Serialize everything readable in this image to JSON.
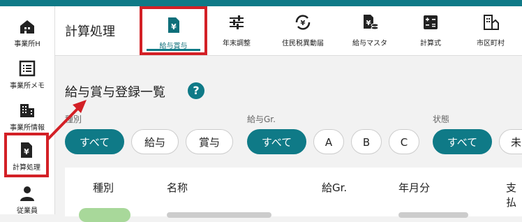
{
  "sidebar": {
    "items": [
      {
        "label": "事業所H",
        "icon": "office-home-icon"
      },
      {
        "label": "事業所メモ",
        "icon": "memo-list-icon"
      },
      {
        "label": "事業所情報",
        "icon": "building-icon"
      },
      {
        "label": "計算処理",
        "icon": "yen-document-icon"
      },
      {
        "label": "従業員",
        "icon": "person-icon"
      }
    ]
  },
  "header": {
    "title": "計算処理",
    "tabs": [
      {
        "label": "給与賞与",
        "icon": "yen-document-icon"
      },
      {
        "label": "年末調整",
        "icon": "sliders-icon"
      },
      {
        "label": "住民税異動届",
        "icon": "yen-cycle-icon"
      },
      {
        "label": "給与マスタ",
        "icon": "yen-database-icon"
      },
      {
        "label": "計算式",
        "icon": "calculator-icon"
      },
      {
        "label": "市区町村",
        "icon": "city-building-icon"
      }
    ]
  },
  "main": {
    "section_title": "給与賞与登録一覧",
    "help_glyph": "?",
    "filters": {
      "type_label": "種別",
      "type_chips": [
        "すべて",
        "給与",
        "賞与"
      ],
      "group_label": "給与Gr.",
      "group_chips": [
        "すべて",
        "A",
        "B",
        "C"
      ],
      "status_label": "状態",
      "status_chips": [
        "すべて",
        "未"
      ]
    },
    "table": {
      "headers": [
        "種別",
        "名称",
        "給Gr.",
        "年月分",
        "支払"
      ]
    }
  },
  "colors": {
    "accent": "#0f7a87",
    "highlight": "#d32026"
  }
}
